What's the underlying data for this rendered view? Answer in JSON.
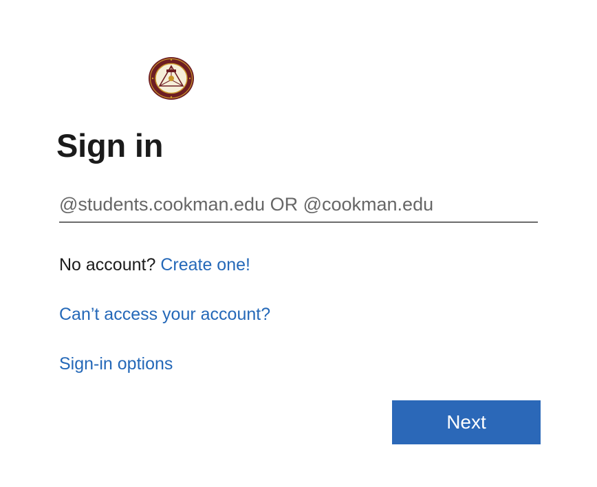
{
  "logo": {
    "name": "university-seal-icon",
    "colors": {
      "maroon": "#6d1d23",
      "gold": "#c9962a",
      "cream": "#f6efd9"
    }
  },
  "page": {
    "title": "Sign in"
  },
  "email": {
    "placeholder": "@students.cookman.edu OR @cookman.edu",
    "value": ""
  },
  "no_account": {
    "text": "No account?",
    "link": "Create one!"
  },
  "cant_access": {
    "link": "Can’t access your account?"
  },
  "signin_options": {
    "link": "Sign-in options"
  },
  "actions": {
    "next_label": "Next"
  },
  "colors": {
    "accent": "#2b68b8",
    "link": "#2468b8",
    "text": "#1b1b1b"
  }
}
